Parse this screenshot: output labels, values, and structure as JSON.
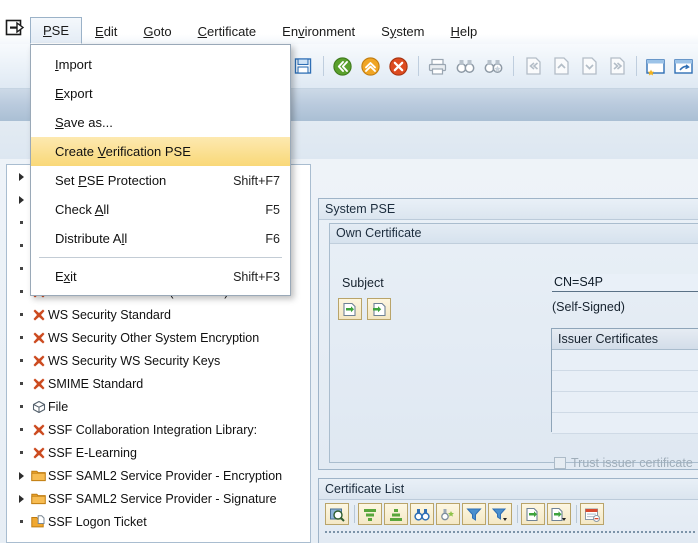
{
  "window": {
    "corner_icon": "sap-exit-icon"
  },
  "menubar": {
    "items": [
      {
        "label": "PSE",
        "name": "menu-pse",
        "accel": "P",
        "open": true
      },
      {
        "label": "Edit",
        "name": "menu-edit",
        "accel": "E",
        "open": false
      },
      {
        "label": "Goto",
        "name": "menu-goto",
        "accel": "G",
        "open": false
      },
      {
        "label": "Certificate",
        "name": "menu-certificate",
        "accel": "C",
        "open": false
      },
      {
        "label": "Environment",
        "name": "menu-environment",
        "accel": "v",
        "open": false
      },
      {
        "label": "System",
        "name": "menu-system",
        "accel": "y",
        "open": false
      },
      {
        "label": "Help",
        "name": "menu-help",
        "accel": "H",
        "open": false
      }
    ]
  },
  "dropdown": {
    "title": "PSE",
    "items": [
      {
        "label": "Import",
        "accel": "I",
        "shortcut": "",
        "selected": false,
        "separator_after": false
      },
      {
        "label": "Export",
        "accel": "E",
        "shortcut": "",
        "selected": false,
        "separator_after": false
      },
      {
        "label": "Save as...",
        "accel": "S",
        "shortcut": "",
        "selected": false,
        "separator_after": false
      },
      {
        "label": "Create Verification PSE",
        "accel": "V",
        "shortcut": "",
        "selected": true,
        "separator_after": false
      },
      {
        "label": "Set PSE Protection",
        "accel": "P",
        "shortcut": "Shift+F7",
        "selected": false,
        "separator_after": false
      },
      {
        "label": "Check All",
        "accel": "A",
        "shortcut": "F5",
        "selected": false,
        "separator_after": false
      },
      {
        "label": "Distribute All",
        "accel": "l",
        "shortcut": "F6",
        "selected": false,
        "separator_after": true
      },
      {
        "label": "Exit",
        "accel": "x",
        "shortcut": "Shift+F3",
        "selected": false,
        "separator_after": false
      }
    ]
  },
  "toolbar": {
    "buttons": [
      {
        "name": "save-button",
        "icon": "save-icon"
      },
      {
        "name": "back-button",
        "icon": "back-green-icon"
      },
      {
        "name": "exit-button",
        "icon": "up-yellow-icon"
      },
      {
        "name": "cancel-button",
        "icon": "cancel-red-icon"
      },
      {
        "name": "print-button",
        "icon": "print-icon"
      },
      {
        "name": "find-button",
        "icon": "binoculars-icon"
      },
      {
        "name": "find-next-button",
        "icon": "binoculars-plus-icon"
      },
      {
        "name": "first-page-button",
        "icon": "page-first-icon"
      },
      {
        "name": "prev-page-button",
        "icon": "page-up-icon"
      },
      {
        "name": "next-page-button",
        "icon": "page-down-icon"
      },
      {
        "name": "last-page-button",
        "icon": "page-last-icon"
      },
      {
        "name": "create-session-button",
        "icon": "new-window-icon"
      },
      {
        "name": "shortcut-button",
        "icon": "shortcut-icon"
      }
    ]
  },
  "tree": {
    "items": [
      {
        "label": "",
        "icon": "none",
        "node": "arrow",
        "name": "tree-node-1"
      },
      {
        "label": "",
        "icon": "none",
        "node": "arrow",
        "name": "tree-node-2"
      },
      {
        "label": "",
        "icon": "none",
        "node": "dot",
        "name": "tree-node-3"
      },
      {
        "label": "",
        "icon": "none",
        "node": "dot",
        "name": "tree-node-4"
      },
      {
        "label": "",
        "icon": "none",
        "node": "dot",
        "name": "tree-node-5"
      },
      {
        "label": "SSL client SSL Client (Standard)",
        "icon": "red-x",
        "node": "dot",
        "name": "tree-item-ssl-client-standard"
      },
      {
        "label": "WS Security Standard",
        "icon": "red-x",
        "node": "dot",
        "name": "tree-item-ws-security-standard"
      },
      {
        "label": "WS Security Other System Encryption",
        "icon": "red-x",
        "node": "dot",
        "name": "tree-item-ws-security-other-system-encryption"
      },
      {
        "label": "WS Security WS Security Keys",
        "icon": "red-x",
        "node": "dot",
        "name": "tree-item-ws-security-keys"
      },
      {
        "label": "SMIME Standard",
        "icon": "red-x",
        "node": "dot",
        "name": "tree-item-smime-standard"
      },
      {
        "label": "File",
        "icon": "cube",
        "node": "dot",
        "name": "tree-item-file"
      },
      {
        "label": "SSF Collaboration Integration Library:",
        "icon": "red-x",
        "node": "dot",
        "name": "tree-item-ssf-collaboration-integration-library"
      },
      {
        "label": "SSF E-Learning",
        "icon": "red-x",
        "node": "dot",
        "name": "tree-item-ssf-e-learning"
      },
      {
        "label": "SSF SAML2 Service Provider - Encryption",
        "icon": "folder",
        "node": "arrow",
        "name": "tree-item-ssf-saml2-encryption"
      },
      {
        "label": "SSF SAML2 Service Provider - Signature",
        "icon": "folder",
        "node": "arrow",
        "name": "tree-item-ssf-saml2-signature"
      },
      {
        "label": "SSF Logon Ticket",
        "icon": "folder-doc",
        "node": "dot",
        "name": "tree-item-ssf-logon-ticket"
      }
    ]
  },
  "main": {
    "system_pse": {
      "title": "System PSE",
      "own_certificate": {
        "title": "Own Certificate",
        "subject_label": "Subject",
        "subject_value": "CN=S4P",
        "self_signed": "(Self-Signed)",
        "buttons": [
          {
            "name": "import-certificate-button",
            "icon": "import-cert-icon"
          },
          {
            "name": "export-certificate-button",
            "icon": "export-cert-icon"
          }
        ],
        "issuer_table": {
          "header": "Issuer Certificates",
          "rows": [
            "",
            "",
            "",
            ""
          ]
        },
        "trust_checkbox": {
          "label": "Trust issuer certificate",
          "checked": false,
          "disabled": true
        }
      }
    },
    "certificate_list": {
      "title": "Certificate List",
      "buttons": [
        {
          "name": "display-detail-button",
          "icon": "magnify-icon"
        },
        {
          "name": "sort-ascending-button",
          "icon": "sort-asc-icon"
        },
        {
          "name": "sort-descending-button",
          "icon": "sort-desc-icon"
        },
        {
          "name": "find-button",
          "icon": "binoculars-icon"
        },
        {
          "name": "find-next-button",
          "icon": "find-next-icon"
        },
        {
          "name": "filter-button",
          "icon": "filter-icon"
        },
        {
          "name": "export-button",
          "icon": "export-icon"
        },
        {
          "name": "delete-filter-button",
          "icon": "delete-row-icon"
        }
      ]
    }
  },
  "colors": {
    "menu_highlight": "#f9d878",
    "panel_blue": "#dfe8f2",
    "title_blue": "#b9cadd",
    "error_red": "#cc4b20",
    "folder_orange": "#f0a830"
  }
}
